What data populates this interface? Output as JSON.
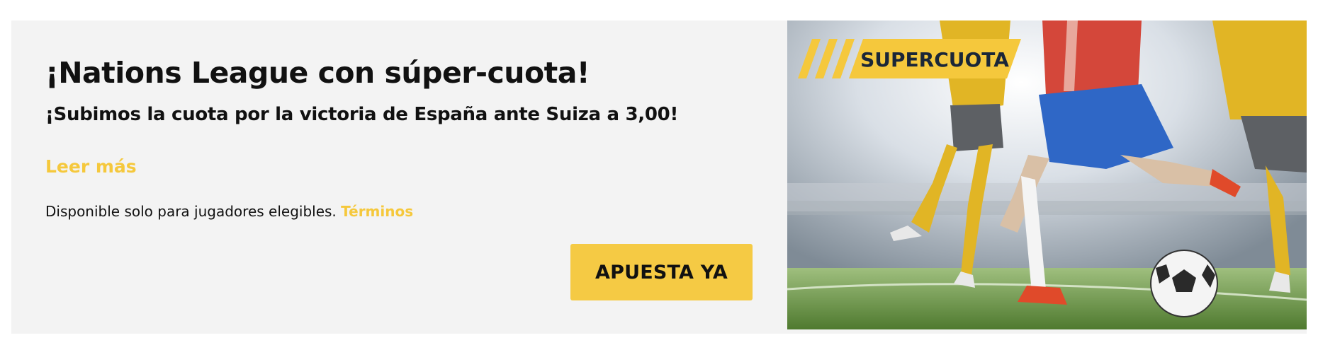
{
  "promo": {
    "title": "¡Nations League con súper-cuota!",
    "subtitle": "¡Subimos la cuota por la victoria de España ante Suiza a 3,00!",
    "read_more": "Leer más",
    "disclaimer": "Disponible solo para jugadores elegibles.",
    "terms_link": "Términos",
    "cta_label": "APUESTA YA"
  },
  "hero": {
    "badge_text": "SUPERCUOTA"
  },
  "colors": {
    "accent": "#f5c83c",
    "panel_background": "#f3f3f3",
    "text": "#111111"
  }
}
